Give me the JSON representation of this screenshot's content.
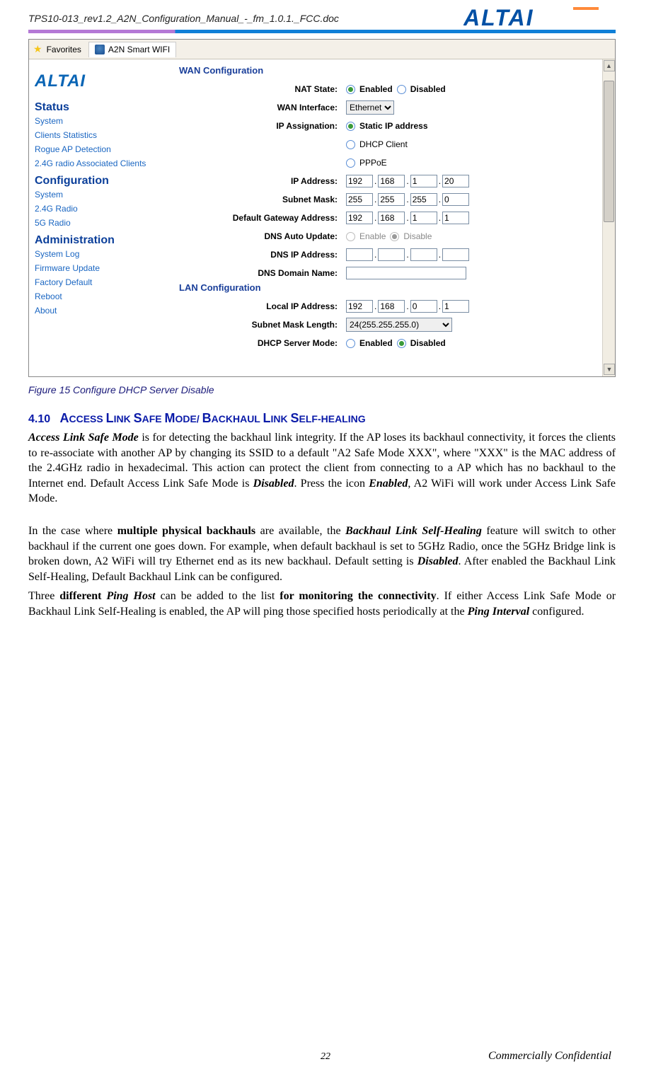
{
  "doc_header": "TPS10-013_rev1.2_A2N_Configuration_Manual_-_fm_1.0.1._FCC.doc",
  "logo_text": "ALTAI",
  "favorites": {
    "label": "Favorites",
    "tab_label": "A2N Smart WIFI"
  },
  "sidebar": {
    "status_h": "Status",
    "status_items": [
      "System",
      "Clients Statistics",
      "Rogue AP Detection",
      "2.4G radio Associated Clients"
    ],
    "config_h": "Configuration",
    "config_items": [
      "System",
      "2.4G Radio",
      "5G Radio"
    ],
    "admin_h": "Administration",
    "admin_items": [
      "System Log",
      "Firmware Update",
      "Factory Default",
      "Reboot",
      "About"
    ]
  },
  "cfg": {
    "wan_h": "WAN Configuration",
    "lan_h": "LAN Configuration",
    "nat_label": "NAT State:",
    "wan_if_label": "WAN Interface:",
    "wan_if_value": "Ethernet",
    "ip_assign_label": "IP Assignation:",
    "ip_assign_opts": [
      "Static IP address",
      "DHCP Client",
      "PPPoE"
    ],
    "ip_addr_label": "IP Address:",
    "ip_addr": [
      "192",
      "168",
      "1",
      "20"
    ],
    "subnet_label": "Subnet Mask:",
    "subnet": [
      "255",
      "255",
      "255",
      "0"
    ],
    "gw_label": "Default Gateway Address:",
    "gw": [
      "192",
      "168",
      "1",
      "1"
    ],
    "dns_auto_label": "DNS Auto Update:",
    "dns_auto_opts": [
      "Enable",
      "Disable"
    ],
    "dns_ip_label": "DNS IP Address:",
    "dns_domain_label": "DNS Domain Name:",
    "local_ip_label": "Local IP Address:",
    "local_ip": [
      "192",
      "168",
      "0",
      "1"
    ],
    "mask_len_label": "Subnet Mask Length:",
    "mask_len_value": "24(255.255.255.0)",
    "dhcp_mode_label": "DHCP Server Mode:",
    "enabled": "Enabled",
    "disabled": "Disabled"
  },
  "figure_caption": "Figure 15      Configure DHCP Server Disable",
  "section": {
    "num": "4.10",
    "title_accent": "A",
    "title_rest_1": "CCESS ",
    "title_l": "L",
    "title_rest_2": "INK ",
    "title_s": "S",
    "title_rest_3": "AFE ",
    "title_m": "M",
    "title_rest_4": "ODE/ ",
    "title_b": "B",
    "title_rest_5": "ACKHAUL ",
    "title_l2": "L",
    "title_rest_6": "INK ",
    "title_s2": "S",
    "title_rest_7": "ELF-HEALING"
  },
  "para1_a": "Access Link Safe Mode",
  "para1_b": " is for detecting the backhaul link integrity. If the AP loses its backhaul connectivity, it forces the clients to re-associate with another AP by changing its SSID to a default \"A2 Safe Mode XXX\", where \"XXX\" is the MAC address of the 2.4GHz radio in hexadecimal. This action can protect the client from connecting to a AP which has no backhaul to the Internet end. Default Access Link Safe Mode is ",
  "para1_c": "Disabled",
  "para1_d": ". Press the icon ",
  "para1_e": "Enabled",
  "para1_f": ", A2 WiFi will work under Access Link Safe Mode.",
  "para2_a": "In the case where ",
  "para2_b": "multiple physical backhauls",
  "para2_c": " are available, the ",
  "para2_d": "Backhaul Link Self-Healing",
  "para2_e": " feature will switch to other backhaul if the current one goes down. For example, when default backhaul is set to 5GHz Radio, once the 5GHz Bridge link is broken down, A2    WiFi will try Ethernet end as its new backhaul. Default setting is ",
  "para2_f": "Disabled",
  "para2_g": ". After enabled the Backhaul Link Self-Healing, Default Backhaul Link can be configured.",
  "para3_a": "Three ",
  "para3_b": "different ",
  "para3_c": "Ping Host",
  "para3_d": " can be added to the list ",
  "para3_e": "for monitoring the connectivity",
  "para3_f": ". If either Access Link Safe Mode or Backhaul Link Self-Healing is enabled, the AP will ping those specified hosts periodically at the ",
  "para3_g": "Ping Interval",
  "para3_h": " configured.",
  "page_number": "22",
  "confidential": "Commercially Confidential"
}
